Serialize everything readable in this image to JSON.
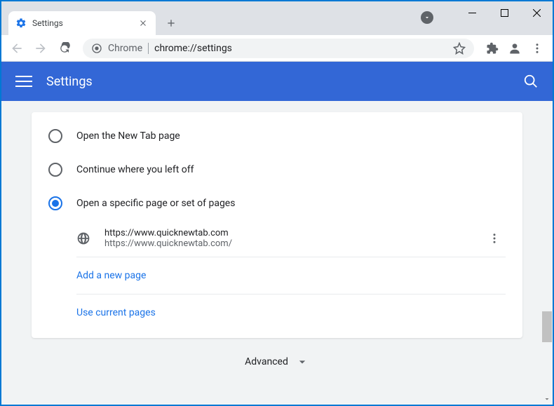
{
  "browser": {
    "tab_title": "Settings",
    "omnibox_prefix": "Chrome",
    "omnibox_url": "chrome://settings"
  },
  "header": {
    "title": "Settings"
  },
  "startup": {
    "options": [
      {
        "label": "Open the New Tab page",
        "selected": false
      },
      {
        "label": "Continue where you left off",
        "selected": false
      },
      {
        "label": "Open a specific page or set of pages",
        "selected": true
      }
    ],
    "pages": [
      {
        "title": "https://www.quicknewtab.com",
        "url": "https://www.quicknewtab.com/"
      }
    ],
    "add_page_label": "Add a new page",
    "use_current_label": "Use current pages"
  },
  "advanced_label": "Advanced"
}
